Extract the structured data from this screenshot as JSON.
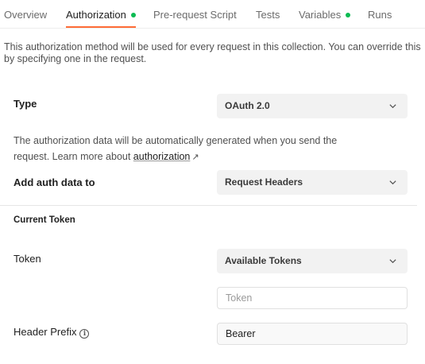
{
  "tabs": [
    {
      "label": "Overview"
    },
    {
      "label": "Authorization"
    },
    {
      "label": "Pre-request Script"
    },
    {
      "label": "Tests"
    },
    {
      "label": "Variables"
    },
    {
      "label": "Runs"
    }
  ],
  "colors": {
    "accent": "#ff6c37",
    "status_dot": "#0cbb52"
  },
  "description": "This authorization method will be used for every request in this collection. You can override this by specifying one in the request.",
  "type": {
    "label": "Type",
    "value": "OAuth 2.0"
  },
  "info": {
    "text": "The authorization data will be automatically generated when you send the request. Learn more about ",
    "link": "authorization",
    "link_icon": "external-arrow-icon"
  },
  "add_auth": {
    "label": "Add auth data to",
    "value": "Request Headers"
  },
  "current_token": {
    "title": "Current Token"
  },
  "token": {
    "label": "Token",
    "select_value": "Available Tokens",
    "placeholder": "Token"
  },
  "header_prefix": {
    "label": "Header Prefix",
    "icon": "info-icon",
    "value": "Bearer"
  }
}
